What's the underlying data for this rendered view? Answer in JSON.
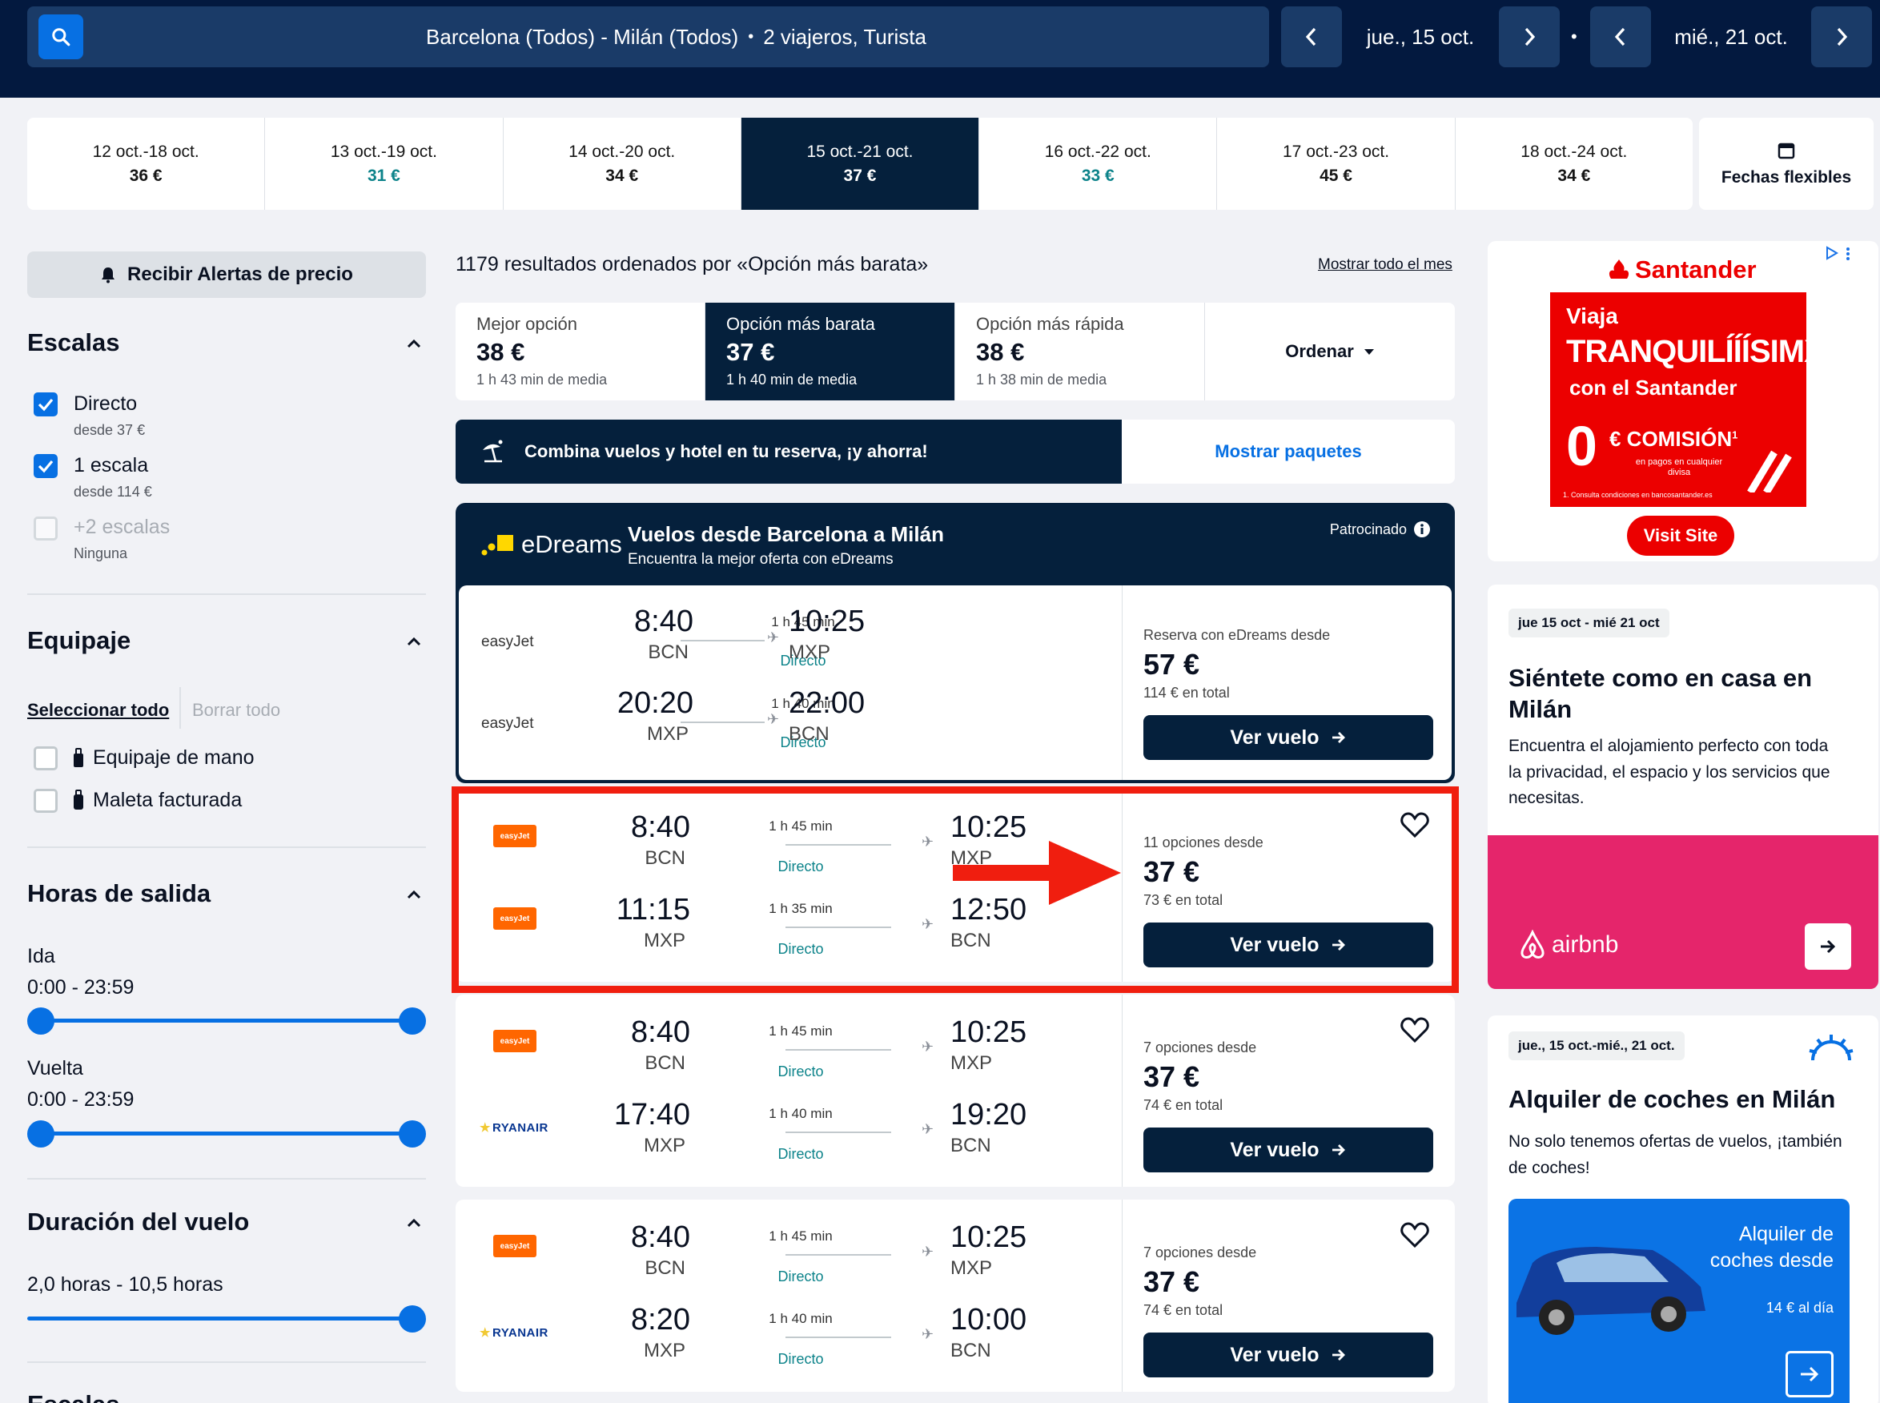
{
  "search": {
    "route": "Barcelona (Todos) - Milán (Todos)",
    "separator": "•",
    "travelers": "2 viajeros, Turista",
    "depart_date": "jue., 15 oct.",
    "return_date": "mié., 21 oct.",
    "dot": "•"
  },
  "date_strip": [
    {
      "dates": "12 oct.-18 oct.",
      "price": "36 €"
    },
    {
      "dates": "13 oct.-19 oct.",
      "price": "31 €"
    },
    {
      "dates": "14 oct.-20 oct.",
      "price": "34 €"
    },
    {
      "dates": "15 oct.-21 oct.",
      "price": "37 €"
    },
    {
      "dates": "16 oct.-22 oct.",
      "price": "33 €"
    },
    {
      "dates": "17 oct.-23 oct.",
      "price": "45 €"
    },
    {
      "dates": "18 oct.-24 oct.",
      "price": "34 €"
    }
  ],
  "flexible_dates": "Fechas flexibles",
  "sidebar": {
    "alert_btn": "Recibir Alertas de precio",
    "stops_title": "Escalas",
    "stops": [
      {
        "label": "Directo",
        "sub": "desde 37 €",
        "checked": true
      },
      {
        "label": "1 escala",
        "sub": "desde 114 €",
        "checked": true
      },
      {
        "label": "+2 escalas",
        "sub": "Ninguna",
        "checked": false
      }
    ],
    "baggage_title": "Equipaje",
    "select_all": "Seleccionar todo",
    "clear_all": "Borrar todo",
    "baggage": [
      "Equipaje de mano",
      "Maleta facturada"
    ],
    "times_title": "Horas de salida",
    "outbound": "Ida",
    "outbound_range": "0:00 - 23:59",
    "return": "Vuelta",
    "return_range": "0:00 - 23:59",
    "duration_title": "Duración del vuelo",
    "duration_range": "2,0 horas - 10,5 horas",
    "duration_level": 1.0,
    "next_title": "Escalas"
  },
  "results": {
    "count_text": "1179 resultados ordenados por «Opción más barata»",
    "show_month": "Mostrar todo el mes",
    "sort_tabs": [
      {
        "title": "Mejor opción",
        "price": "38 €",
        "avg": "1 h 43 min de media"
      },
      {
        "title": "Opción más barata",
        "price": "37 €",
        "avg": "1 h 40 min de media"
      },
      {
        "title": "Opción más rápida",
        "price": "38 €",
        "avg": "1 h 38 min de media"
      }
    ],
    "order_label": "Ordenar",
    "combo_text": "Combina vuelos y hotel en tu reserva, ¡y ahorra!",
    "combo_link": "Mostrar paquetes"
  },
  "edreams": {
    "logo": "eDreams",
    "title": "Vuelos desde Barcelona a Milán",
    "subtitle": "Encuentra la mejor oferta con eDreams",
    "sponsored": "Patrocinado",
    "legs": [
      {
        "airline": "easyJet",
        "dep": "8:40",
        "dep_code": "BCN",
        "dur": "1 h 45 min",
        "stops": "Directo",
        "arr": "10:25",
        "arr_code": "MXP"
      },
      {
        "airline": "easyJet",
        "dep": "20:20",
        "dep_code": "MXP",
        "dur": "1 h 40 min",
        "stops": "Directo",
        "arr": "22:00",
        "arr_code": "BCN"
      }
    ],
    "from_text": "Reserva con eDreams desde",
    "price": "57 €",
    "total": "114 € en total",
    "button": "Ver vuelo"
  },
  "flights": [
    {
      "legs": [
        {
          "airline": "easyJet",
          "dep": "8:40",
          "dep_code": "BCN",
          "dur": "1 h 45 min",
          "stops": "Directo",
          "arr": "10:25",
          "arr_code": "MXP"
        },
        {
          "airline": "easyJet",
          "dep": "11:15",
          "dep_code": "MXP",
          "dur": "1 h 35 min",
          "stops": "Directo",
          "arr": "12:50",
          "arr_code": "BCN"
        }
      ],
      "options": "11 opciones desde",
      "price": "37 €",
      "total": "73 € en total",
      "button": "Ver vuelo"
    },
    {
      "legs": [
        {
          "airline": "easyJet",
          "dep": "8:40",
          "dep_code": "BCN",
          "dur": "1 h 45 min",
          "stops": "Directo",
          "arr": "10:25",
          "arr_code": "MXP"
        },
        {
          "airline": "RYANAIR",
          "dep": "17:40",
          "dep_code": "MXP",
          "dur": "1 h 40 min",
          "stops": "Directo",
          "arr": "19:20",
          "arr_code": "BCN"
        }
      ],
      "options": "7 opciones desde",
      "price": "37 €",
      "total": "74 € en total",
      "button": "Ver vuelo"
    },
    {
      "legs": [
        {
          "airline": "easyJet",
          "dep": "8:40",
          "dep_code": "BCN",
          "dur": "1 h 45 min",
          "stops": "Directo",
          "arr": "10:25",
          "arr_code": "MXP"
        },
        {
          "airline": "RYANAIR",
          "dep": "8:20",
          "dep_code": "MXP",
          "dur": "1 h 40 min",
          "stops": "Directo",
          "arr": "10:00",
          "arr_code": "BCN"
        }
      ],
      "options": "7 opciones desde",
      "price": "37 €",
      "total": "74 € en total",
      "button": "Ver vuelo"
    }
  ],
  "ads": {
    "santander": {
      "brand": "Santander",
      "line1": "Viaja",
      "line2": "TRANQUILÍÍÍSIMX",
      "line3": "con el Santander",
      "big": "0",
      "comision": "€ COMISIÓN",
      "sup": "1",
      "small": "en pagos en cualquier divisa",
      "fine": "1. Consulta condiciones en bancosantander.es",
      "button": "Visit Site"
    },
    "airbnb": {
      "tag": "jue 15 oct - mié 21 oct",
      "title": "Siéntete como en casa en Milán",
      "body": "Encuentra el alojamiento perfecto con toda la privacidad, el espacio y los servicios que necesitas.",
      "brand": "airbnb"
    },
    "cars": {
      "tag": "jue., 15 oct.-mié., 21 oct.",
      "title": "Alquiler de coches en Milán",
      "body": "No solo tenemos ofertas de vuelos, ¡también de coches!",
      "box_title": "Alquiler de coches desde",
      "box_price": "14 € al día"
    }
  },
  "colors": {
    "navy": "#05203c",
    "blue": "#0770e3",
    "teal": "#0c838a",
    "highlight_red": "#f01e0f"
  }
}
